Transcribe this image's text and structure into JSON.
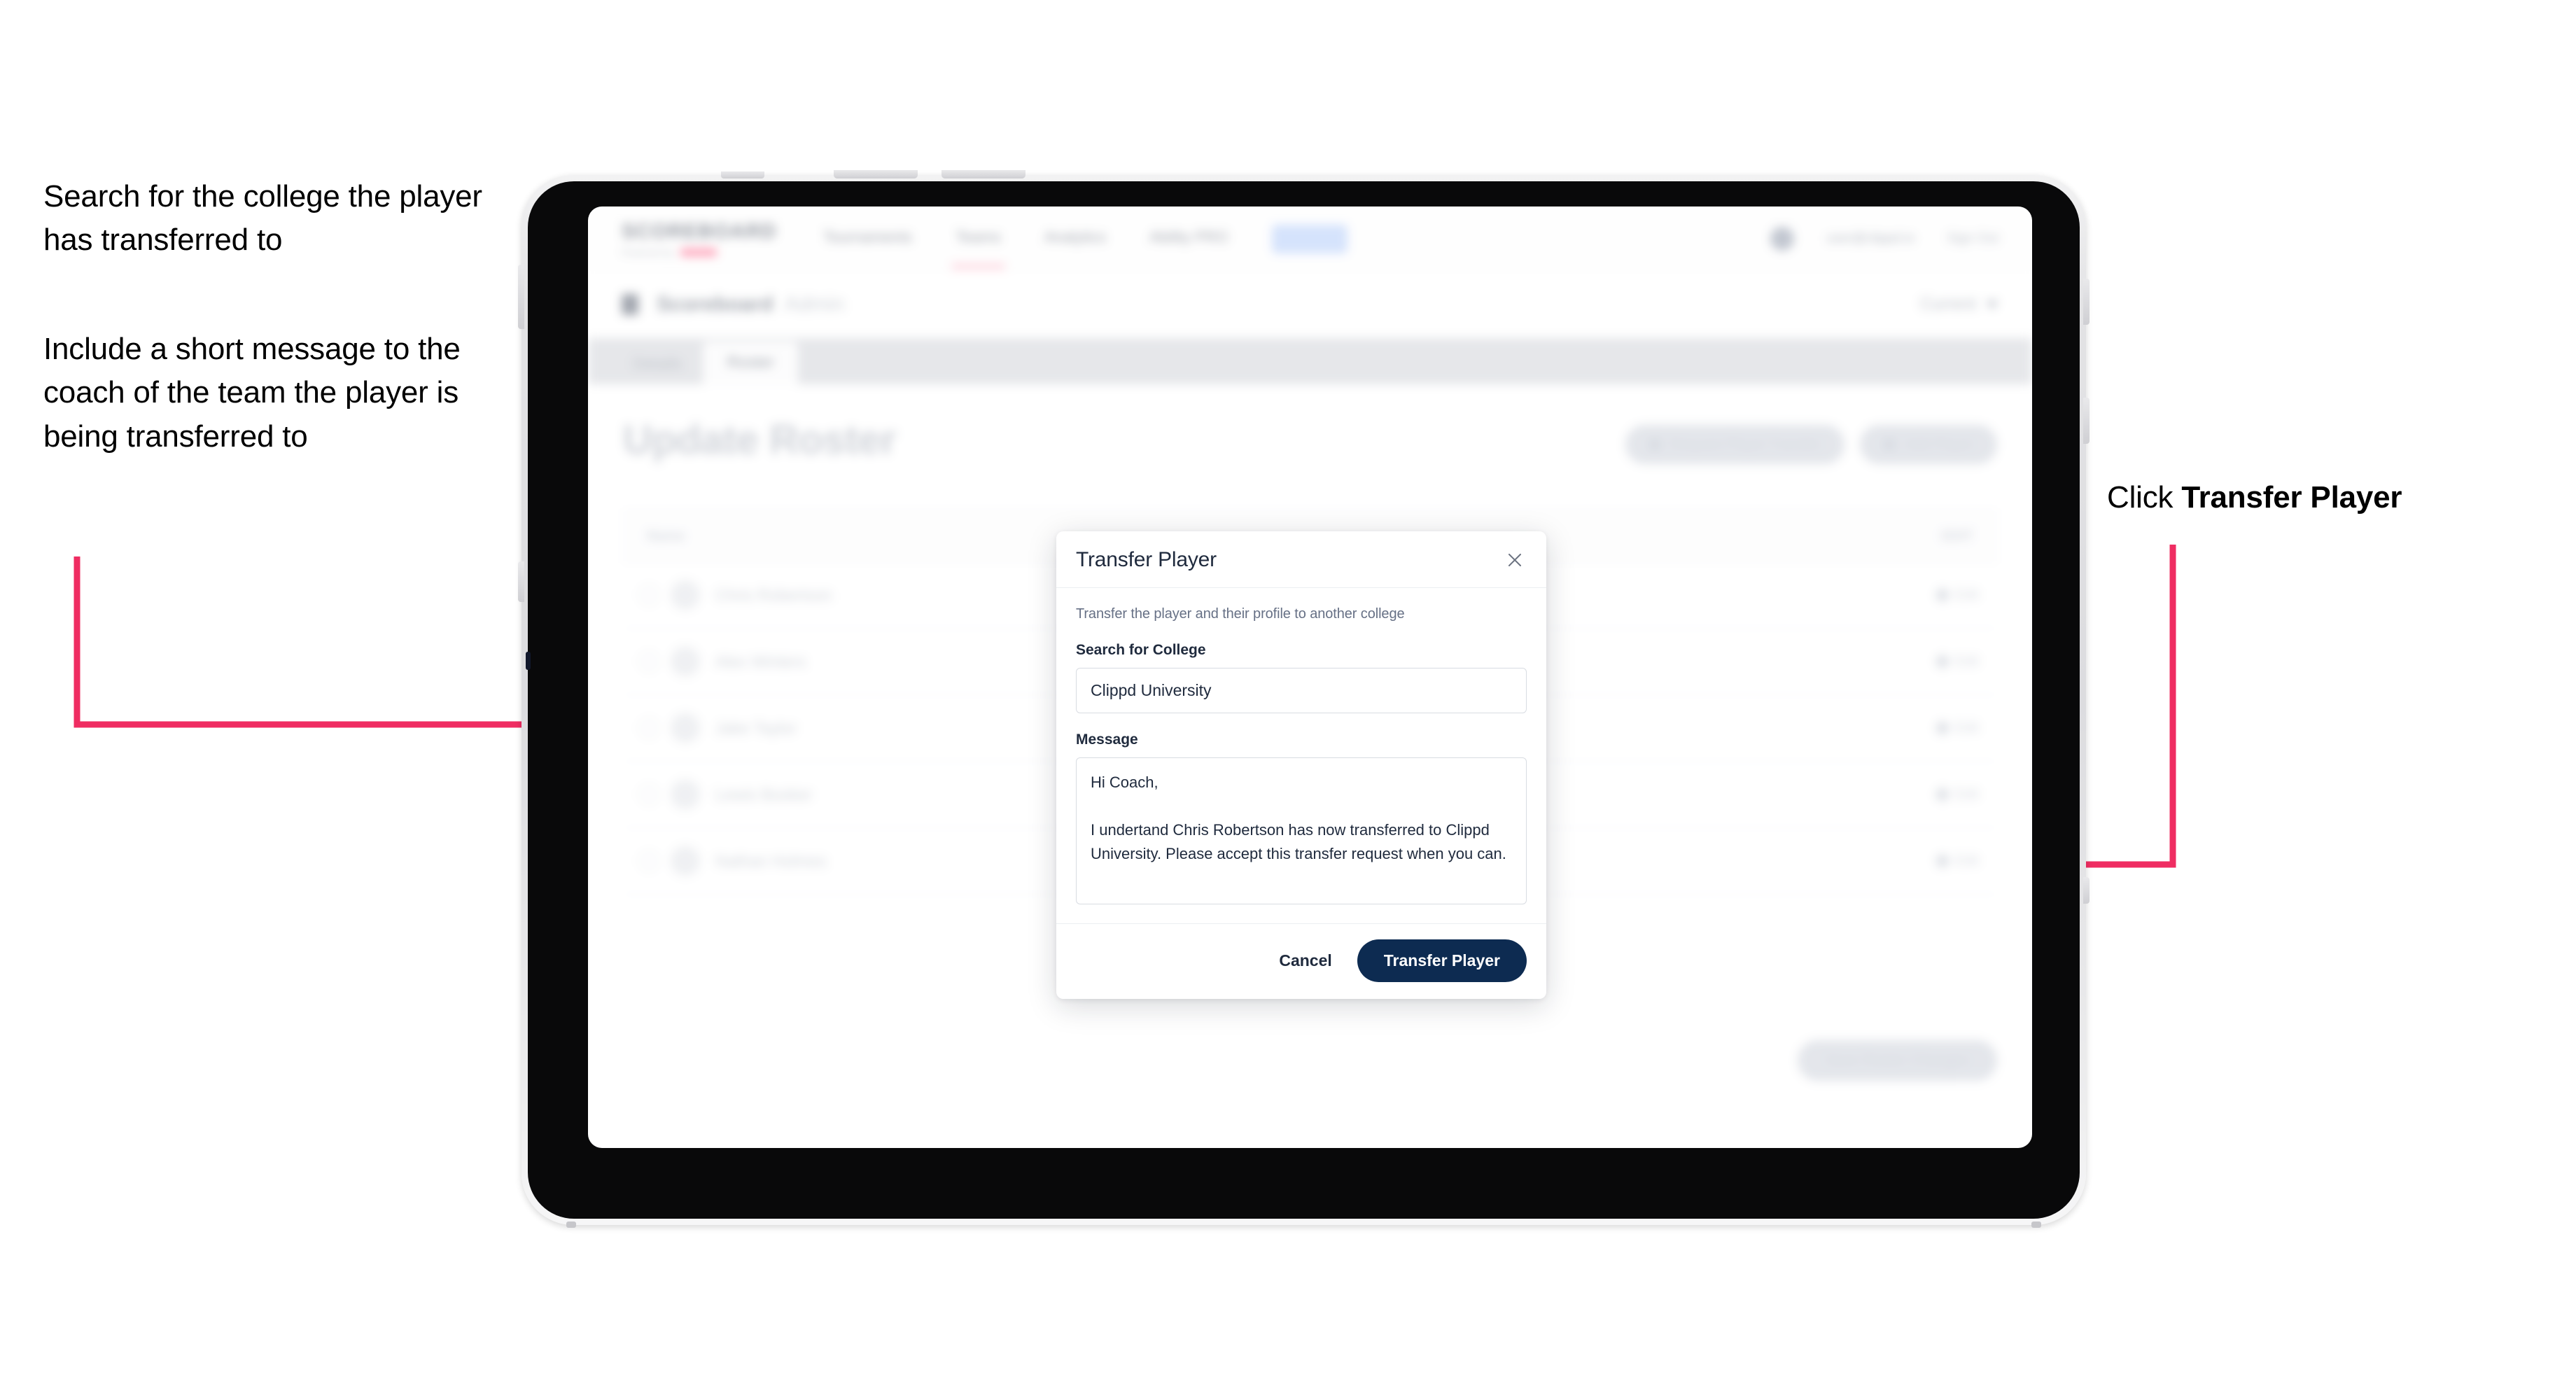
{
  "annotations": {
    "left_1": "Search for the college the player has transferred to",
    "left_2": "Include a short message to the coach of the team the player is being transferred to",
    "right_prefix": "Click ",
    "right_strong": "Transfer Player",
    "arrow_color": "#ef2d62"
  },
  "app": {
    "brand": {
      "word": "SCOREBOARD",
      "sub": "Powered by",
      "sub_badge": ""
    },
    "nav": [
      {
        "label": "Tournaments"
      },
      {
        "label": "Teams"
      },
      {
        "label": "Analytics"
      },
      {
        "label": "Ability PRO"
      },
      {
        "label": "Admin"
      }
    ],
    "header_right": {
      "user_email": "user@clippd.io",
      "sign_out": "Sign Out"
    },
    "breadcrumb": {
      "title": "Scoreboard",
      "subtitle": "Admin",
      "right_label": "Current",
      "icon": "building-icon"
    },
    "tabs": [
      {
        "label": "Details",
        "active": false
      },
      {
        "label": "Roster",
        "active": true
      }
    ],
    "page": {
      "title": "Update Roster",
      "actions": [
        {
          "label": "Request Player Transfer",
          "icon": "transfer-icon"
        },
        {
          "label": "Add Player",
          "icon": "plus-icon"
        }
      ],
      "save_label": "Save Roster Changes"
    },
    "roster": {
      "col_name": "Name",
      "col_edit": "EDIT",
      "rows": [
        {
          "name": "Chris Robertson",
          "edit": "Edit"
        },
        {
          "name": "Alex Winters",
          "edit": "Edit"
        },
        {
          "name": "Jake Taylor",
          "edit": "Edit"
        },
        {
          "name": "Lewis Booker",
          "edit": "Edit"
        },
        {
          "name": "Nathan Holmes",
          "edit": "Edit"
        }
      ]
    }
  },
  "modal": {
    "title": "Transfer Player",
    "close_icon": "close-icon",
    "subtitle": "Transfer the player and their profile to another college",
    "college_label": "Search for College",
    "college_value": "Clippd University",
    "college_placeholder": "Search for College",
    "message_label": "Message",
    "message_value": "Hi Coach,\n\nI undertand Chris Robertson has now transferred to Clippd University. Please accept this transfer request when you can.",
    "message_placeholder": "Message",
    "cancel_label": "Cancel",
    "submit_label": "Transfer Player",
    "submit_color": "#0d2b51"
  }
}
